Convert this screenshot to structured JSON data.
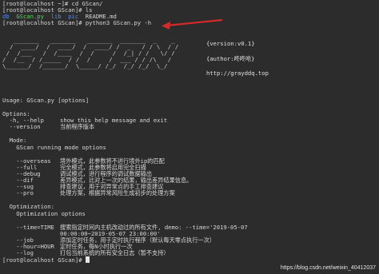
{
  "session": {
    "prompt1": "[root@localhost ~]# ",
    "cmd1": "cd GScan/",
    "prompt2": "[root@localhost GScan]# ",
    "cmd2": "ls",
    "ls_items": [
      "db",
      "GScan.py",
      "lib",
      "pic",
      "README.md"
    ],
    "prompt3": "[root@localhost GScan]# ",
    "cmd3": "python3 GScan.py -h"
  },
  "banner": {
    "ascii_lines": [
      "   _______   _______   _______  _______  _    _",
      "  /  ____/  /  ____/  /  ____/ /  _   / / \\  / /",
      " /  /___   /  /____  /  /     /  /_| / /   \\/ /",
      "/  /__  / /_____  / /  /     /  ___ / / /\\   /",
      "\\______/  /______/  \\_____/ /_/  /_/ /_/  \\_/"
    ],
    "version": "{version:v0.1}",
    "author": "{author:咚咚呛}",
    "url": "http://grayddq.top"
  },
  "usage": "Usage: GScan.py [options]",
  "options": {
    "heading": "Options:",
    "items": [
      {
        "flag": "  -h, --help",
        "desc": "show this help message and exit"
      },
      {
        "flag": "  --version",
        "desc": "当前程序版本"
      }
    ]
  },
  "mode": {
    "heading": "  Mode:",
    "sub": "    GScan running mode options",
    "items": [
      {
        "flag": "    --overseas",
        "desc": "境外模式，此参数将不进行境外ip的匹配"
      },
      {
        "flag": "    --full",
        "desc": "完全模式，此参数将启用完全扫描"
      },
      {
        "flag": "    --debug",
        "desc": "调试模式，进行程序的调试数据输出"
      },
      {
        "flag": "    --dif",
        "desc": "差异模式，比对上一次的结果，输出差异结果信息。"
      },
      {
        "flag": "    --sug",
        "desc": "排查建议，用于对异常点的手工排查建议"
      },
      {
        "flag": "    --pro",
        "desc": "处理方案，根据异常风险生成初步的处理方案"
      }
    ]
  },
  "optimization": {
    "heading": "  Optimization:",
    "sub": "    Optimization options",
    "lines": [
      {
        "flag": "    --time=TIME",
        "desc": "搜索指定时间内主机改动过的所有文件, demo: --time='2019-05-07"
      },
      {
        "flag": "",
        "desc": "00:00:00~2019-05-07 23:00:00'"
      },
      {
        "flag": "    --job",
        "desc": "添加定时任务，用于定时执行程序（默认每天零点执行一次）"
      },
      {
        "flag": "    --hour=HOUR",
        "desc": "定时任务，每N小时执行一次"
      },
      {
        "flag": "    --log",
        "desc": "打包当前系统的所有安全日志（暂不支持）"
      }
    ]
  },
  "final_prompt": "[root@localhost GScan]# ",
  "watermark": "https://blog.csdn.net/weixin_40412037",
  "colors": {
    "background": "#2c2c2c",
    "directory": "#5b8be8",
    "executable": "#5fd35f",
    "arrow": "#d42a2a"
  }
}
